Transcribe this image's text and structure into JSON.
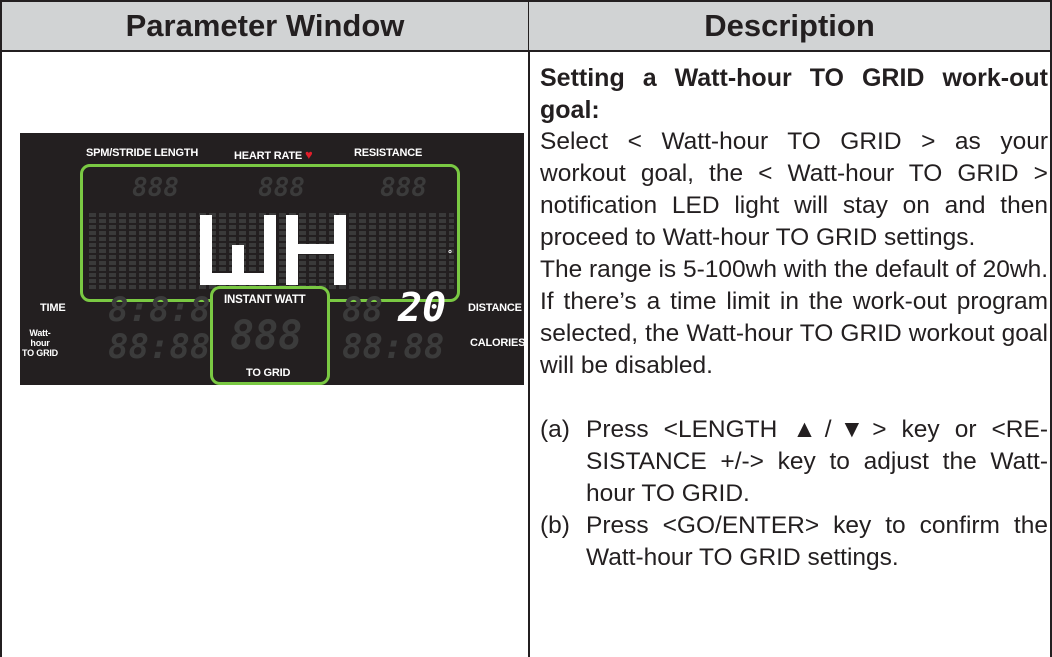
{
  "header": {
    "left": "Parameter Window",
    "right": "Description"
  },
  "console": {
    "labels": {
      "spm": "SPM/STRIDE LENGTH",
      "heart_rate": "HEART RATE",
      "resistance": "RESISTANCE",
      "time": "TIME",
      "watt_hour_line1": "Watt-hour",
      "watt_hour_line2": "TO GRID",
      "instant_watt": "INSTANT WATT",
      "to_grid": "TO GRID",
      "distance": "DISTANCE",
      "calories": "CALORIES"
    },
    "main_display": "WH",
    "value_display": "20"
  },
  "description": {
    "goal_title": "Setting a Watt-hour TO GRID work-out goal:",
    "para1": "Select < Watt-hour TO GRID > as your workout goal, the < Watt-hour TO GRID > notification LED light will stay on and then proceed to Watt-hour TO GRID settings.",
    "para2": "The range is 5-100wh with the default of 20wh. If there’s a time limit in the work-out program selected, the Watt-hour TO GRID workout goal will be disabled.",
    "steps": [
      {
        "label": "(a)",
        "text": "Press <LENGTH ▲/▼> key or <RE-SISTANCE +/-> key to adjust the Watt-hour TO GRID."
      },
      {
        "label": "(b)",
        "text": "Press <GO/ENTER> key to confirm the Watt-hour TO GRID settings."
      }
    ]
  }
}
